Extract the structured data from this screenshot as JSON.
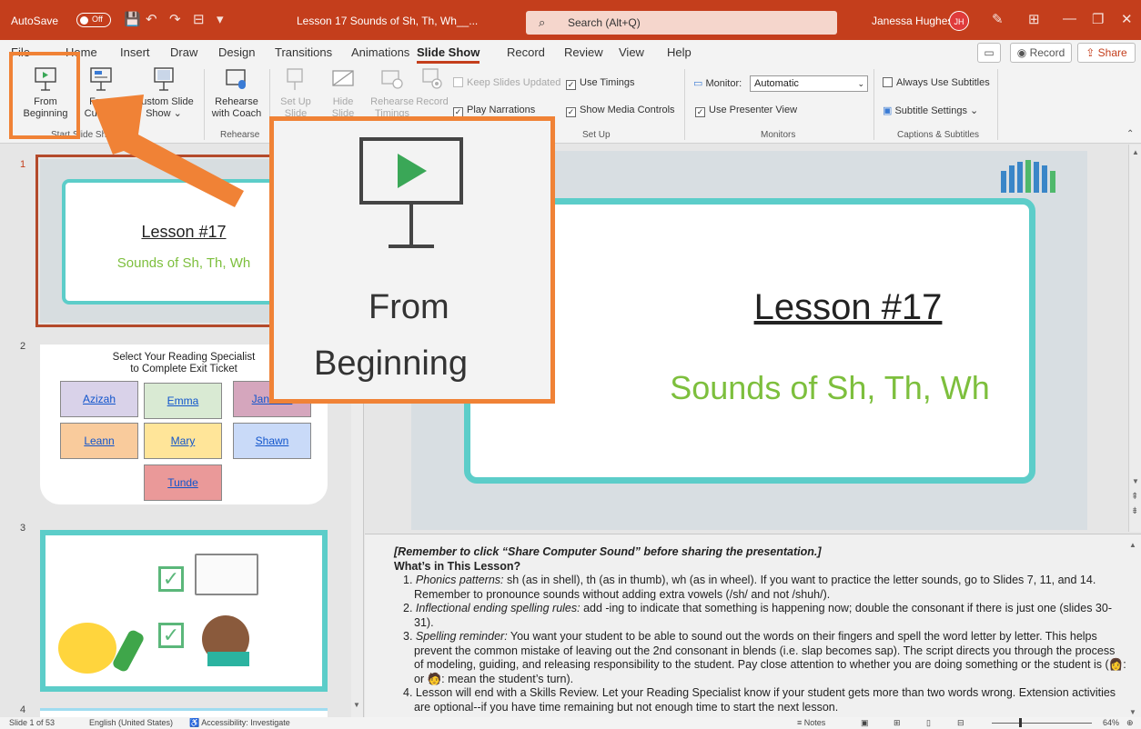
{
  "titlebar": {
    "autosave_label": "AutoSave",
    "autosave_state": "Off",
    "doc_title": "Lesson 17 Sounds of Sh, Th, Wh__...",
    "search_placeholder": "Search (Alt+Q)",
    "user_name": "Janessa Hughes",
    "user_initials": "JH"
  },
  "menu": {
    "tabs": [
      "File",
      "Home",
      "Insert",
      "Draw",
      "Design",
      "Transitions",
      "Animations",
      "Slide Show",
      "Record",
      "Review",
      "View",
      "Help"
    ],
    "active_tab": "Slide Show",
    "record_label": "Record",
    "share_label": "Share"
  },
  "ribbon": {
    "from_beginning": [
      "From",
      "Beginning"
    ],
    "from_current": [
      "From",
      "Current"
    ],
    "custom_slide": [
      "Custom Slide",
      "Show"
    ],
    "rehearse_coach": [
      "Rehearse",
      "with Coach"
    ],
    "setup": [
      "Set Up",
      "Slide Show"
    ],
    "hide": [
      "Hide",
      "Slide"
    ],
    "rehearse_timings": [
      "Rehearse",
      "Timings"
    ],
    "record": "Record",
    "keep_updated": "Keep Slides Updated",
    "use_timings": "Use Timings",
    "play_narrations": "Play Narrations",
    "show_media": "Show Media Controls",
    "monitor_label": "Monitor:",
    "monitor_value": "Automatic",
    "presenter_view": "Use Presenter View",
    "always_subtitles": "Always Use Subtitles",
    "subtitle_settings": "Subtitle Settings",
    "groups": {
      "start": "Start Slide Show",
      "rehearse": "Rehearse",
      "setup": "Set Up",
      "monitors": "Monitors",
      "captions": "Captions & Subtitles"
    }
  },
  "slides": {
    "s1": {
      "num": "1",
      "title": "Lesson #17",
      "subtitle": "Sounds of Sh, Th, Wh"
    },
    "s2": {
      "num": "2",
      "heading": [
        "Select Your Reading Specialist",
        "to Complete Exit Ticket"
      ],
      "names": [
        "Azizah",
        "Emma",
        "Janessa",
        "Leann",
        "Mary",
        "Shawn",
        "Tunde"
      ],
      "colors": [
        "#d9d2e9",
        "#d9ead3",
        "#d5a6bd",
        "#f9cb9c",
        "#ffe599",
        "#c9daf8",
        "#ea9999"
      ]
    },
    "s3": {
      "num": "3"
    },
    "s4": {
      "num": "4"
    }
  },
  "main_slide": {
    "title": "Lesson #17",
    "subtitle": "Sounds of Sh, Th, Wh"
  },
  "notes": {
    "reminder": "[Remember to click “Share Computer Sound” before sharing the presentation.]",
    "heading": "What’s in This Lesson?",
    "items": [
      {
        "num": "1.",
        "lead": "Phonics patterns:",
        "text": " sh (as in shell), th (as in thumb), wh (as in wheel). If you want to practice the letter sounds, go to Slides 7, 11, and 14. Remember to pronounce sounds without adding extra vowels (/sh/ and not /shuh/)."
      },
      {
        "num": "2.",
        "lead": "Inflectional ending spelling rules:",
        "text": " add -ing to indicate that something is happening now; double the consonant if there is just one (slides 30-31)."
      },
      {
        "num": "3.",
        "lead": "Spelling reminder:",
        "text": " You want your student to be able to sound out the words on their fingers and spell the word letter by letter. This helps prevent the common mistake of leaving out the 2nd consonant in blends (i.e. slap becomes sap). The script directs you through the process of modeling, guiding, and releasing responsibility to the student. Pay close attention to whether you are doing something or the student is (👩: or 🧑: mean the student’s turn)."
      },
      {
        "num": "4.",
        "lead": "",
        "text": "Lesson will end with a Skills Review. Let your Reading Specialist know if your student gets more than two words wrong. Extension activities are optional--if you have time remaining but not enough time to start the next lesson."
      }
    ]
  },
  "status": {
    "slide_count": "Slide 1 of 53",
    "language": "English (United States)",
    "accessibility": "Accessibility: Investigate",
    "notes_label": "Notes",
    "zoom": "64%"
  },
  "zoom_callout": {
    "line1": "From",
    "line2": "Beginning"
  },
  "colors": {
    "brand": "#c43e1c",
    "callout": "#f08236",
    "teal": "#5ccdc9",
    "green": "#7dbf3d"
  }
}
